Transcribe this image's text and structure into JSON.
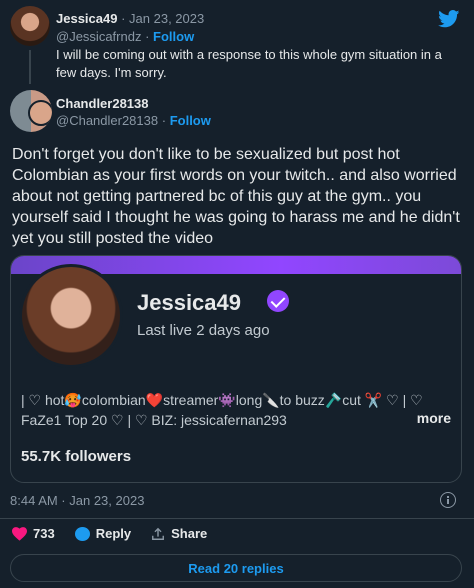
{
  "quoted_tweet": {
    "name": "Jessica49",
    "sep": "·",
    "date": "Jan 23, 2023",
    "handle": "@Jessicafrndz",
    "follow": "Follow",
    "text": "I will be coming out with a response to this whole gym situation in a few days. I'm sorry."
  },
  "tweet": {
    "name": "Chandler28138",
    "handle": "@Chandler28138",
    "follow": "Follow",
    "text": "Don't forget you don't like to be sexualized but post hot Colombian as your first words on your twitch.. and also worried about not getting partnered bc of this guy at the gym.. you yourself said I thought he was going to harass me and he didn't yet you still posted the video",
    "timestamp": "8:44 AM · Jan 23, 2023"
  },
  "card": {
    "name": "Jessica49",
    "last_live": "Last live 2 days ago",
    "bio": "| ♡ hot🥵colombian❤️streamer👾long🔪to buzz🪒cut ✂️ ♡ | ♡ FaZe1 Top 20 ♡ | ♡ BIZ: jessicafernan293",
    "more": "more",
    "followers": "55.7K followers"
  },
  "actions": {
    "likes": "733",
    "reply": "Reply",
    "share": "Share"
  },
  "read_replies": "Read 20 replies",
  "colors": {
    "background": "#15202b",
    "accent": "#1d9bf0",
    "like": "#f91880",
    "twitch": "#9146ff"
  },
  "icons": [
    "twitter-bird-icon",
    "verified-icon",
    "info-icon",
    "heart-icon",
    "reply-icon",
    "share-icon"
  ]
}
